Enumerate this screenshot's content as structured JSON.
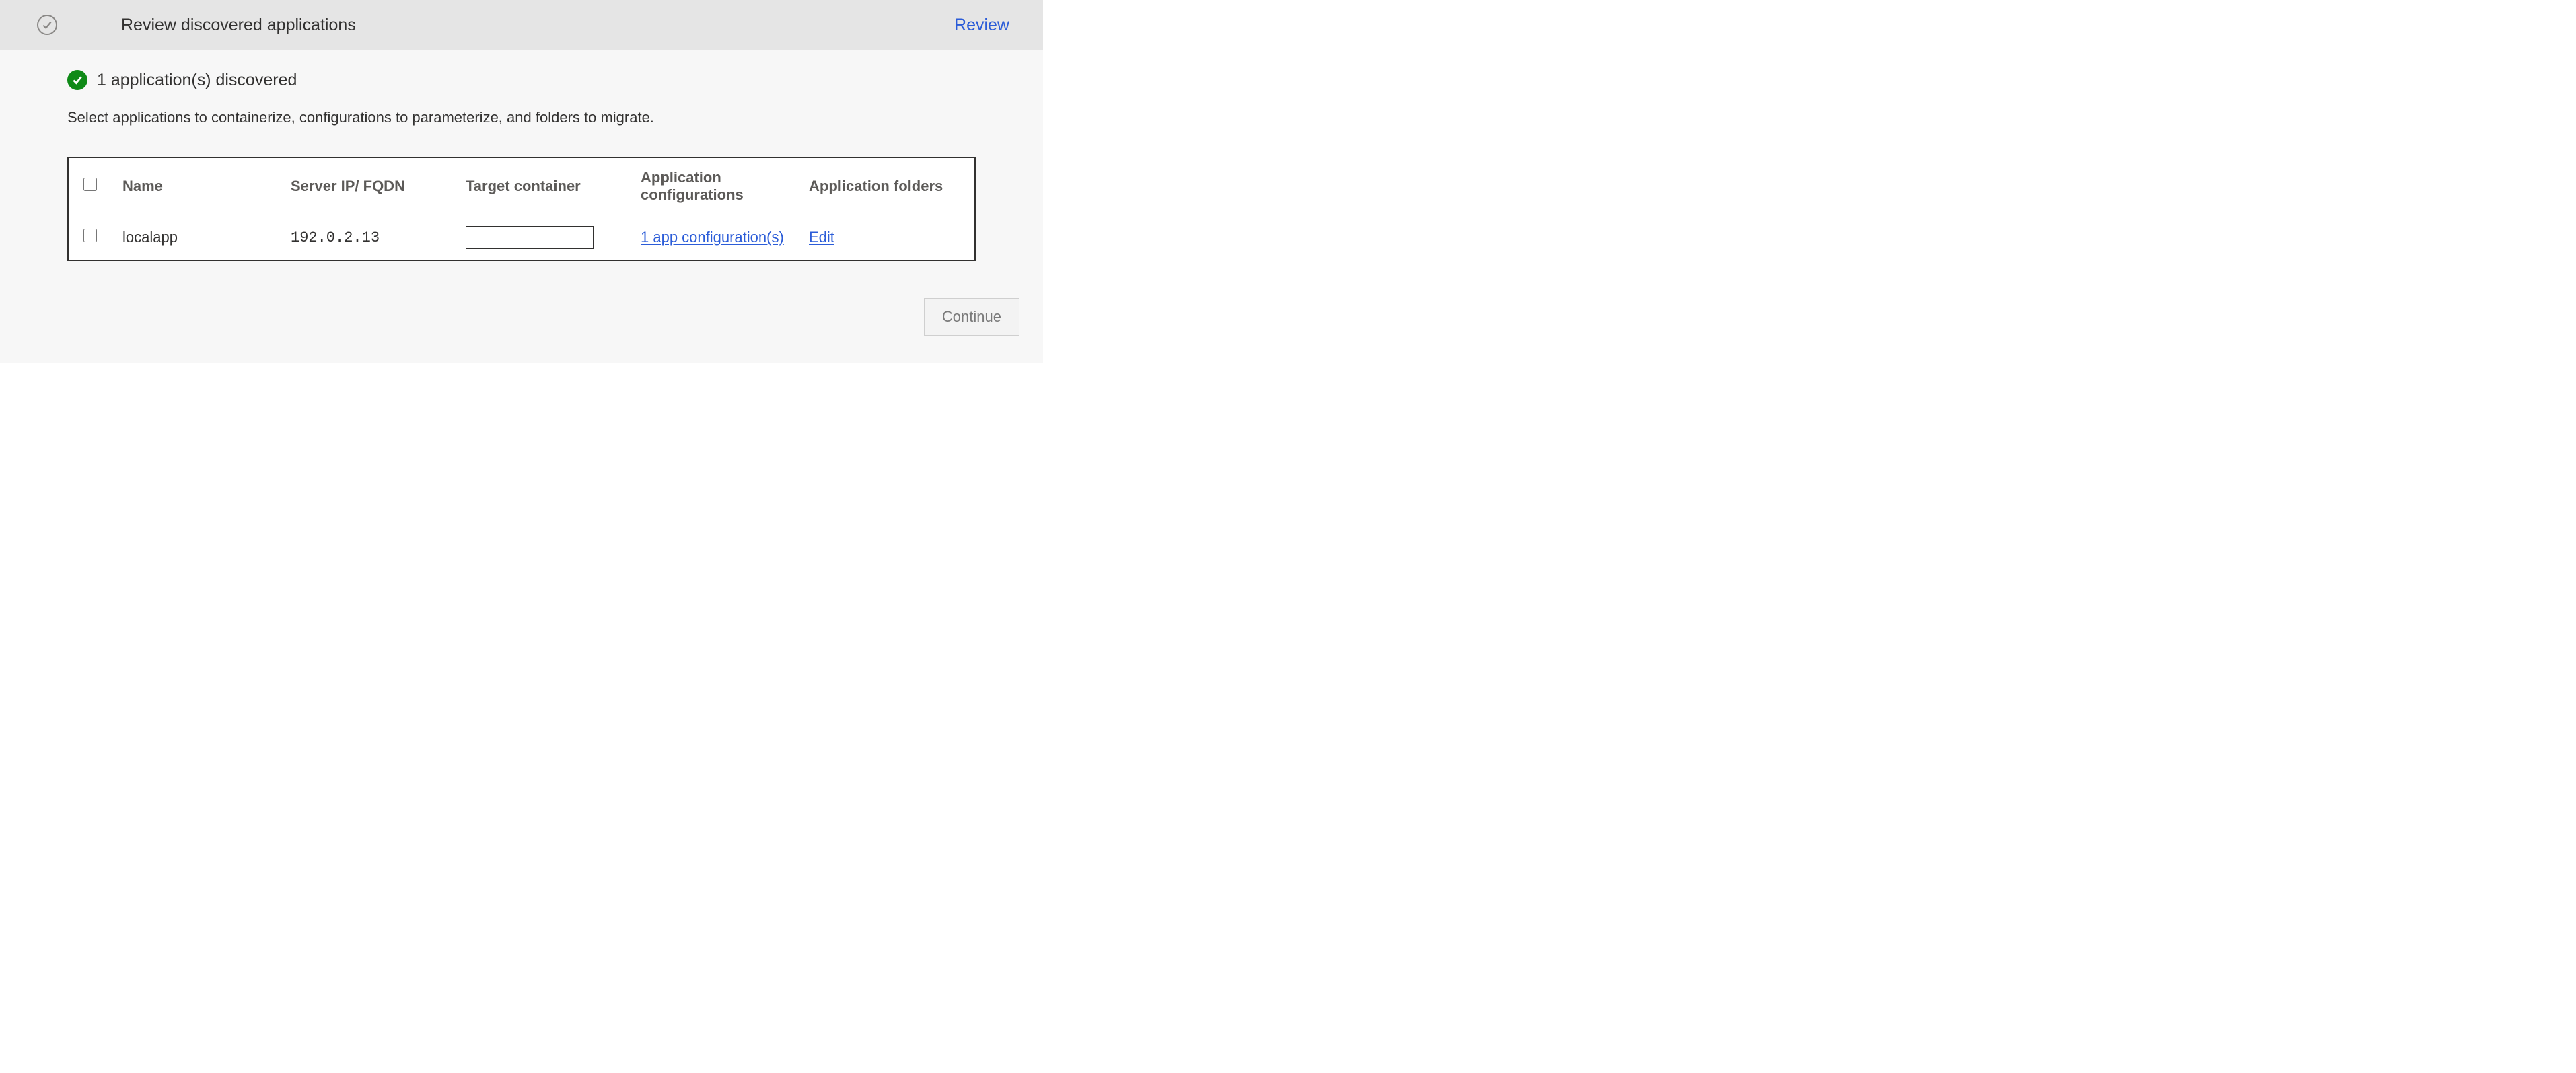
{
  "strip": {
    "title": "Review discovered applications",
    "actionLabel": "Review"
  },
  "status": {
    "text": "1 application(s) discovered"
  },
  "description": "Select applications to containerize, configurations to parameterize, and folders to migrate.",
  "table": {
    "headers": {
      "name": "Name",
      "ip": "Server IP/ FQDN",
      "target": "Target container",
      "cfg": "Application configurations",
      "folders": "Application folders"
    },
    "rows": [
      {
        "name": "localapp",
        "ip": "192.0.2.13",
        "target": "",
        "cfgLink": "1 app configuration(s)",
        "foldersLink": "Edit"
      }
    ]
  },
  "footer": {
    "continueLabel": "Continue"
  }
}
